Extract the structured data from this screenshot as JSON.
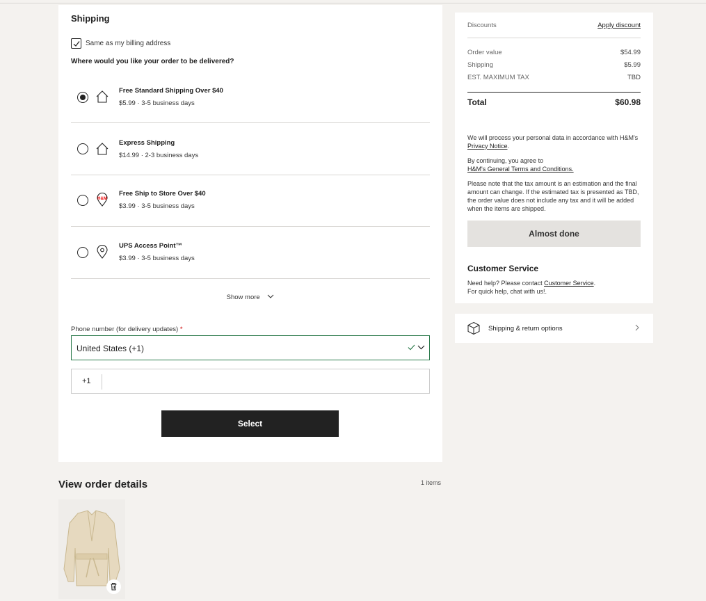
{
  "shipping": {
    "title": "Shipping",
    "billing_checkbox_label": "Same as my billing address",
    "billing_checked": true,
    "question": "Where would you like your order to be delivered?",
    "options": [
      {
        "name": "Free Standard Shipping Over $40",
        "detail": "$5.99 · 3-5 business days",
        "icon": "home-icon",
        "selected": true
      },
      {
        "name": "Express Shipping",
        "detail": "$14.99 · 2-3 business days",
        "icon": "home-icon",
        "selected": false
      },
      {
        "name": "Free Ship to Store Over $40",
        "detail": "$3.99 · 3-5 business days",
        "icon": "hm-store-pin-icon",
        "selected": false
      },
      {
        "name": "UPS Access Point™",
        "detail": "$3.99 · 3-5 business days",
        "icon": "location-pin-icon",
        "selected": false
      }
    ],
    "show_more": "Show more",
    "phone_label": "Phone number (for delivery updates)",
    "required_mark": "*",
    "country_value": "United States (+1)",
    "phone_prefix": "+1",
    "phone_value": "",
    "select_button": "Select"
  },
  "order": {
    "title": "View order details",
    "count": "1 items"
  },
  "summary": {
    "discounts_label": "Discounts",
    "apply_discount": "Apply discount",
    "order_value_label": "Order value",
    "order_value": "$54.99",
    "shipping_label": "Shipping",
    "shipping_value": "$5.99",
    "tax_label": "EST. MAXIMUM TAX",
    "tax_value": "TBD",
    "total_label": "Total",
    "total_value": "$60.98",
    "privacy_text": "We will process your personal data in accordance with H&M's",
    "privacy_link": "Privacy Notice",
    "terms_text": "By continuing, you agree to",
    "terms_link": "H&M's General Terms and Conditions.",
    "tax_note": "Please note that the tax amount is an estimation and the final amount can change. If the estimated tax is presented as TBD, the order value does not include any tax and it will be added when the items are shipped.",
    "almost_done_button": "Almost done",
    "cs_title": "Customer Service",
    "cs_text": "Need help? Please contact",
    "cs_link": "Customer Service",
    "cs_text2": "For quick help, chat with us!."
  },
  "shipping_return": {
    "label": "Shipping & return options"
  },
  "colors": {
    "accent_dark": "#222222",
    "valid_green": "#2b7a4b",
    "required_red": "#cc0000",
    "page_bg": "#f4f2ef"
  }
}
